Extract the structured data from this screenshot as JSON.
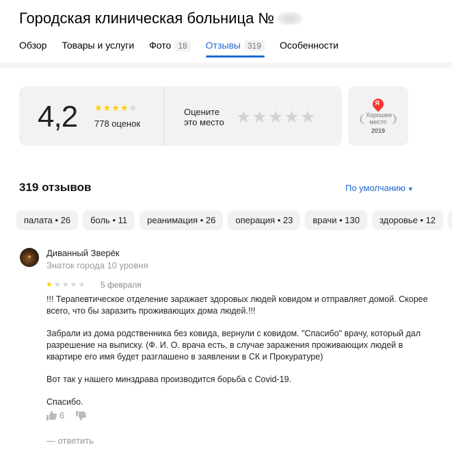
{
  "header": {
    "title": "Городская клиническая больница №",
    "tabs": [
      {
        "label": "Обзор",
        "count": ""
      },
      {
        "label": "Товары и услуги",
        "count": ""
      },
      {
        "label": "Фото",
        "count": "18"
      },
      {
        "label": "Отзывы",
        "count": "319",
        "active": true
      },
      {
        "label": "Особенности",
        "count": ""
      }
    ]
  },
  "rating": {
    "value": "4,2",
    "stars_filled": 4,
    "stars_total": 5,
    "count_label": "778 оценок",
    "rate_prompt": "Оцените это место",
    "rate_stars": [
      "★",
      "★",
      "★",
      "★",
      "★"
    ]
  },
  "award": {
    "logo_letter": "Я",
    "text": "Хорошее место",
    "year": "2019"
  },
  "reviews": {
    "title": "319 отзывов",
    "sort_label": "По умолчанию",
    "chips": [
      "палата • 26",
      "боль • 11",
      "реанимация • 26",
      "операция • 23",
      "врачи • 130",
      "здоровье • 12",
      "ме"
    ]
  },
  "review": {
    "author": "Диванный Зверёк",
    "level": "Знаток города 10 уровня",
    "stars_filled": 1,
    "stars_total": 5,
    "date": "5 февраля",
    "paragraphs": [
      "!!! Терапевтическое отделение заражает здоровых людей ковидом и отправляет домой. Скорее всего, что бы заразить проживающих дома людей.!!!",
      "Забрали из дома родственника без ковида, вернули с ковидом. \"Спасибо\" врачу, который дал разрешение на выписку. (Ф. И. О. врача есть, в случае заражения проживающих людей в квартире его имя будет разглашено в заявлении в СК и Прокуратуре)",
      "Вот так у нашего минздрава производится борьба с Covid-19.",
      "Спасибо."
    ],
    "likes": "6",
    "reply_label": "— ответить"
  },
  "colors": {
    "accent": "#2467d3",
    "star_on": "#ffcc00",
    "card_bg": "#f2f2f2"
  }
}
